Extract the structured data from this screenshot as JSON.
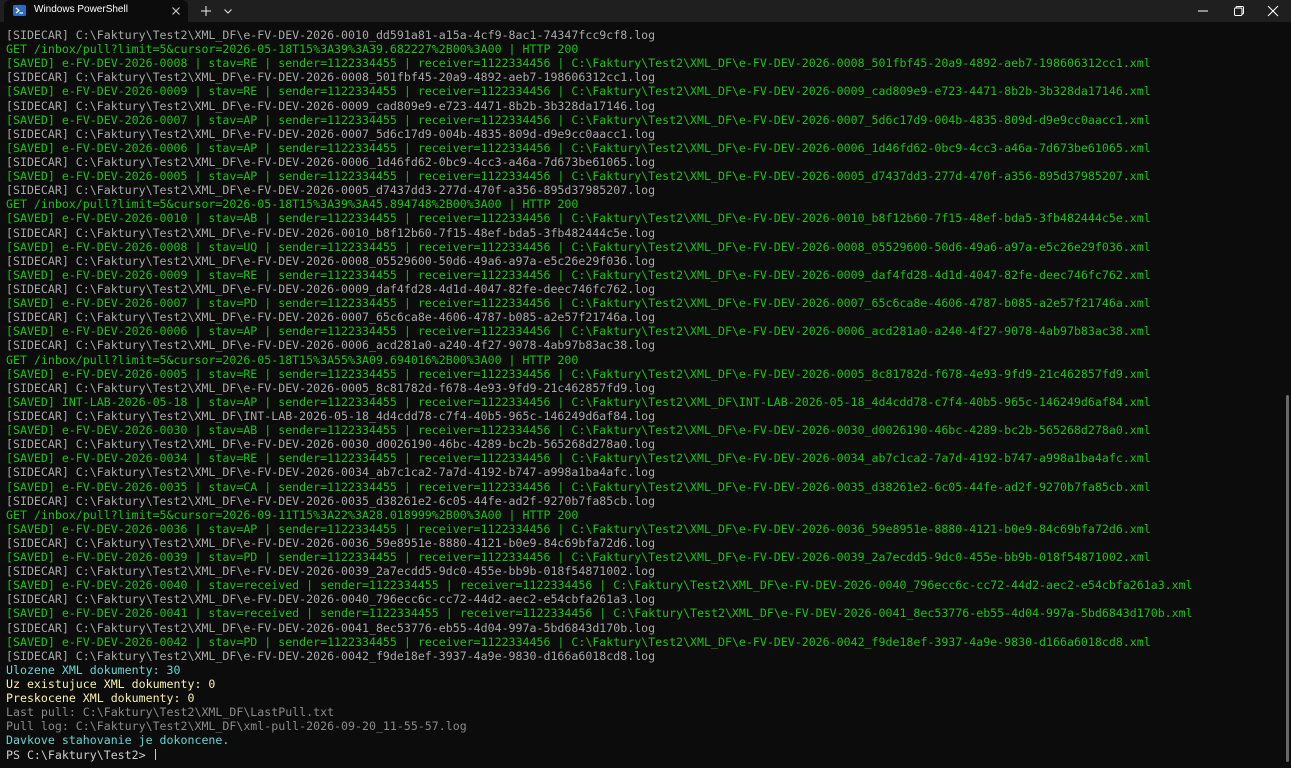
{
  "window": {
    "tab_title": "Windows PowerShell"
  },
  "icons": {
    "tab": "powershell-icon",
    "tab_close": "close-icon",
    "new_tab": "plus-icon",
    "dropdown": "chevron-down-icon",
    "minimize": "minimize-icon",
    "maximize": "maximize-icon",
    "close": "close-icon"
  },
  "colors": {
    "background": "#0c0c0c",
    "titlebar": "#1f1f1f",
    "saved": "#16c60c",
    "sidecar": "#a8a8a8",
    "cyan": "#61d6d6",
    "yellow": "#f9f1a5"
  },
  "terminal": {
    "lines": [
      {
        "type": "sidecar",
        "text": "[SIDECAR] C:\\Faktury\\Test2\\XML_DF\\e-FV-DEV-2026-0010_dd591a81-a15a-4cf9-8ac1-74347fcc9cf8.log"
      },
      {
        "type": "get",
        "text": "GET /inbox/pull?limit=5&cursor=2026-05-18T15%3A39%3A39.682227%2B00%3A00 | HTTP 200"
      },
      {
        "type": "saved",
        "text": "[SAVED] e-FV-DEV-2026-0008 | stav=RE | sender=1122334455 | receiver=1122334456 | C:\\Faktury\\Test2\\XML_DF\\e-FV-DEV-2026-0008_501fbf45-20a9-4892-aeb7-198606312cc1.xml"
      },
      {
        "type": "sidecar",
        "text": "[SIDECAR] C:\\Faktury\\Test2\\XML_DF\\e-FV-DEV-2026-0008_501fbf45-20a9-4892-aeb7-198606312cc1.log"
      },
      {
        "type": "saved",
        "text": "[SAVED] e-FV-DEV-2026-0009 | stav=RE | sender=1122334455 | receiver=1122334456 | C:\\Faktury\\Test2\\XML_DF\\e-FV-DEV-2026-0009_cad809e9-e723-4471-8b2b-3b328da17146.xml"
      },
      {
        "type": "sidecar",
        "text": "[SIDECAR] C:\\Faktury\\Test2\\XML_DF\\e-FV-DEV-2026-0009_cad809e9-e723-4471-8b2b-3b328da17146.log"
      },
      {
        "type": "saved",
        "text": "[SAVED] e-FV-DEV-2026-0007 | stav=AP | sender=1122334455 | receiver=1122334456 | C:\\Faktury\\Test2\\XML_DF\\e-FV-DEV-2026-0007_5d6c17d9-004b-4835-809d-d9e9cc0aacc1.xml"
      },
      {
        "type": "sidecar",
        "text": "[SIDECAR] C:\\Faktury\\Test2\\XML_DF\\e-FV-DEV-2026-0007_5d6c17d9-004b-4835-809d-d9e9cc0aacc1.log"
      },
      {
        "type": "saved",
        "text": "[SAVED] e-FV-DEV-2026-0006 | stav=AP | sender=1122334455 | receiver=1122334456 | C:\\Faktury\\Test2\\XML_DF\\e-FV-DEV-2026-0006_1d46fd62-0bc9-4cc3-a46a-7d673be61065.xml"
      },
      {
        "type": "sidecar",
        "text": "[SIDECAR] C:\\Faktury\\Test2\\XML_DF\\e-FV-DEV-2026-0006_1d46fd62-0bc9-4cc3-a46a-7d673be61065.log"
      },
      {
        "type": "saved",
        "text": "[SAVED] e-FV-DEV-2026-0005 | stav=AP | sender=1122334455 | receiver=1122334456 | C:\\Faktury\\Test2\\XML_DF\\e-FV-DEV-2026-0005_d7437dd3-277d-470f-a356-895d37985207.xml"
      },
      {
        "type": "sidecar",
        "text": "[SIDECAR] C:\\Faktury\\Test2\\XML_DF\\e-FV-DEV-2026-0005_d7437dd3-277d-470f-a356-895d37985207.log"
      },
      {
        "type": "get",
        "text": "GET /inbox/pull?limit=5&cursor=2026-05-18T15%3A39%3A45.894748%2B00%3A00 | HTTP 200"
      },
      {
        "type": "saved",
        "text": "[SAVED] e-FV-DEV-2026-0010 | stav=AB | sender=1122334455 | receiver=1122334456 | C:\\Faktury\\Test2\\XML_DF\\e-FV-DEV-2026-0010_b8f12b60-7f15-48ef-bda5-3fb482444c5e.xml"
      },
      {
        "type": "sidecar",
        "text": "[SIDECAR] C:\\Faktury\\Test2\\XML_DF\\e-FV-DEV-2026-0010_b8f12b60-7f15-48ef-bda5-3fb482444c5e.log"
      },
      {
        "type": "saved",
        "text": "[SAVED] e-FV-DEV-2026-0008 | stav=UQ | sender=1122334455 | receiver=1122334456 | C:\\Faktury\\Test2\\XML_DF\\e-FV-DEV-2026-0008_05529600-50d6-49a6-a97a-e5c26e29f036.xml"
      },
      {
        "type": "sidecar",
        "text": "[SIDECAR] C:\\Faktury\\Test2\\XML_DF\\e-FV-DEV-2026-0008_05529600-50d6-49a6-a97a-e5c26e29f036.log"
      },
      {
        "type": "saved",
        "text": "[SAVED] e-FV-DEV-2026-0009 | stav=RE | sender=1122334455 | receiver=1122334456 | C:\\Faktury\\Test2\\XML_DF\\e-FV-DEV-2026-0009_daf4fd28-4d1d-4047-82fe-deec746fc762.xml"
      },
      {
        "type": "sidecar",
        "text": "[SIDECAR] C:\\Faktury\\Test2\\XML_DF\\e-FV-DEV-2026-0009_daf4fd28-4d1d-4047-82fe-deec746fc762.log"
      },
      {
        "type": "saved",
        "text": "[SAVED] e-FV-DEV-2026-0007 | stav=PD | sender=1122334455 | receiver=1122334456 | C:\\Faktury\\Test2\\XML_DF\\e-FV-DEV-2026-0007_65c6ca8e-4606-4787-b085-a2e57f21746a.xml"
      },
      {
        "type": "sidecar",
        "text": "[SIDECAR] C:\\Faktury\\Test2\\XML_DF\\e-FV-DEV-2026-0007_65c6ca8e-4606-4787-b085-a2e57f21746a.log"
      },
      {
        "type": "saved",
        "text": "[SAVED] e-FV-DEV-2026-0006 | stav=AP | sender=1122334455 | receiver=1122334456 | C:\\Faktury\\Test2\\XML_DF\\e-FV-DEV-2026-0006_acd281a0-a240-4f27-9078-4ab97b83ac38.xml"
      },
      {
        "type": "sidecar",
        "text": "[SIDECAR] C:\\Faktury\\Test2\\XML_DF\\e-FV-DEV-2026-0006_acd281a0-a240-4f27-9078-4ab97b83ac38.log"
      },
      {
        "type": "get",
        "text": "GET /inbox/pull?limit=5&cursor=2026-05-18T15%3A55%3A09.694016%2B00%3A00 | HTTP 200"
      },
      {
        "type": "saved",
        "text": "[SAVED] e-FV-DEV-2026-0005 | stav=RE | sender=1122334455 | receiver=1122334456 | C:\\Faktury\\Test2\\XML_DF\\e-FV-DEV-2026-0005_8c81782d-f678-4e93-9fd9-21c462857fd9.xml"
      },
      {
        "type": "sidecar",
        "text": "[SIDECAR] C:\\Faktury\\Test2\\XML_DF\\e-FV-DEV-2026-0005_8c81782d-f678-4e93-9fd9-21c462857fd9.log"
      },
      {
        "type": "saved",
        "text": "[SAVED] INT-LAB-2026-05-18 | stav=AP | sender=1122334455 | receiver=1122334456 | C:\\Faktury\\Test2\\XML_DF\\INT-LAB-2026-05-18_4d4cdd78-c7f4-40b5-965c-146249d6af84.xml"
      },
      {
        "type": "sidecar",
        "text": "[SIDECAR] C:\\Faktury\\Test2\\XML_DF\\INT-LAB-2026-05-18_4d4cdd78-c7f4-40b5-965c-146249d6af84.log"
      },
      {
        "type": "saved",
        "text": "[SAVED] e-FV-DEV-2026-0030 | stav=AB | sender=1122334455 | receiver=1122334456 | C:\\Faktury\\Test2\\XML_DF\\e-FV-DEV-2026-0030_d0026190-46bc-4289-bc2b-565268d278a0.xml"
      },
      {
        "type": "sidecar",
        "text": "[SIDECAR] C:\\Faktury\\Test2\\XML_DF\\e-FV-DEV-2026-0030_d0026190-46bc-4289-bc2b-565268d278a0.log"
      },
      {
        "type": "saved",
        "text": "[SAVED] e-FV-DEV-2026-0034 | stav=RE | sender=1122334455 | receiver=1122334456 | C:\\Faktury\\Test2\\XML_DF\\e-FV-DEV-2026-0034_ab7c1ca2-7a7d-4192-b747-a998a1ba4afc.xml"
      },
      {
        "type": "sidecar",
        "text": "[SIDECAR] C:\\Faktury\\Test2\\XML_DF\\e-FV-DEV-2026-0034_ab7c1ca2-7a7d-4192-b747-a998a1ba4afc.log"
      },
      {
        "type": "saved",
        "text": "[SAVED] e-FV-DEV-2026-0035 | stav=CA | sender=1122334455 | receiver=1122334456 | C:\\Faktury\\Test2\\XML_DF\\e-FV-DEV-2026-0035_d38261e2-6c05-44fe-ad2f-9270b7fa85cb.xml"
      },
      {
        "type": "sidecar",
        "text": "[SIDECAR] C:\\Faktury\\Test2\\XML_DF\\e-FV-DEV-2026-0035_d38261e2-6c05-44fe-ad2f-9270b7fa85cb.log"
      },
      {
        "type": "get",
        "text": "GET /inbox/pull?limit=5&cursor=2026-09-11T15%3A22%3A28.018999%2B00%3A00 | HTTP 200"
      },
      {
        "type": "saved",
        "text": "[SAVED] e-FV-DEV-2026-0036 | stav=AP | sender=1122334455 | receiver=1122334456 | C:\\Faktury\\Test2\\XML_DF\\e-FV-DEV-2026-0036_59e8951e-8880-4121-b0e9-84c69bfa72d6.xml"
      },
      {
        "type": "sidecar",
        "text": "[SIDECAR] C:\\Faktury\\Test2\\XML_DF\\e-FV-DEV-2026-0036_59e8951e-8880-4121-b0e9-84c69bfa72d6.log"
      },
      {
        "type": "saved",
        "text": "[SAVED] e-FV-DEV-2026-0039 | stav=PD | sender=1122334455 | receiver=1122334456 | C:\\Faktury\\Test2\\XML_DF\\e-FV-DEV-2026-0039_2a7ecdd5-9dc0-455e-bb9b-018f54871002.xml"
      },
      {
        "type": "sidecar",
        "text": "[SIDECAR] C:\\Faktury\\Test2\\XML_DF\\e-FV-DEV-2026-0039_2a7ecdd5-9dc0-455e-bb9b-018f54871002.log"
      },
      {
        "type": "saved",
        "text": "[SAVED] e-FV-DEV-2026-0040 | stav=received | sender=1122334455 | receiver=1122334456 | C:\\Faktury\\Test2\\XML_DF\\e-FV-DEV-2026-0040_796ecc6c-cc72-44d2-aec2-e54cbfa261a3.xml"
      },
      {
        "type": "sidecar",
        "text": "[SIDECAR] C:\\Faktury\\Test2\\XML_DF\\e-FV-DEV-2026-0040_796ecc6c-cc72-44d2-aec2-e54cbfa261a3.log"
      },
      {
        "type": "saved",
        "text": "[SAVED] e-FV-DEV-2026-0041 | stav=received | sender=1122334455 | receiver=1122334456 | C:\\Faktury\\Test2\\XML_DF\\e-FV-DEV-2026-0041_8ec53776-eb55-4d04-997a-5bd6843d170b.xml"
      },
      {
        "type": "sidecar",
        "text": "[SIDECAR] C:\\Faktury\\Test2\\XML_DF\\e-FV-DEV-2026-0041_8ec53776-eb55-4d04-997a-5bd6843d170b.log"
      },
      {
        "type": "saved",
        "text": "[SAVED] e-FV-DEV-2026-0042 | stav=PD | sender=1122334455 | receiver=1122334456 | C:\\Faktury\\Test2\\XML_DF\\e-FV-DEV-2026-0042_f9de18ef-3937-4a9e-9830-d166a6018cd8.xml"
      },
      {
        "type": "sidecar",
        "text": "[SIDECAR] C:\\Faktury\\Test2\\XML_DF\\e-FV-DEV-2026-0042_f9de18ef-3937-4a9e-9830-d166a6018cd8.log"
      },
      {
        "type": "cyan",
        "text": "Ulozene XML dokumenty: 30"
      },
      {
        "type": "yellow",
        "text": "Uz existujuce XML dokumenty: 0"
      },
      {
        "type": "yellow",
        "text": "Preskocene XML dokumenty: 0"
      },
      {
        "type": "gray",
        "text": "Last pull: C:\\Faktury\\Test2\\XML_DF\\LastPull.txt"
      },
      {
        "type": "gray",
        "text": "Pull log: C:\\Faktury\\Test2\\XML_DF\\xml-pull-2026-09-20_11-55-57.log"
      },
      {
        "type": "cyan",
        "text": "Davkove stahovanie je dokoncene."
      },
      {
        "type": "prompt",
        "text": "PS C:\\Faktury\\Test2> "
      }
    ]
  }
}
